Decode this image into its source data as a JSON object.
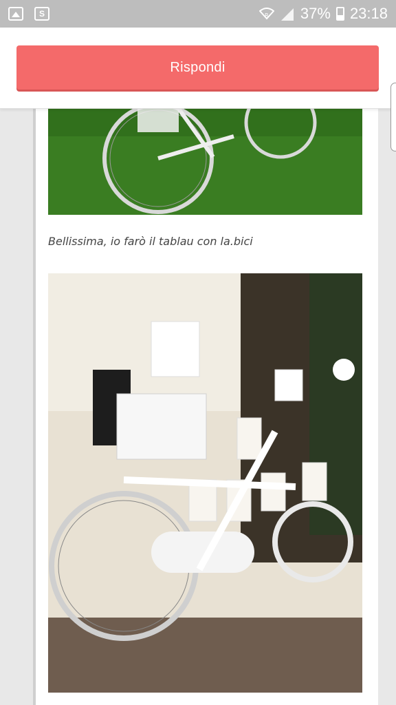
{
  "status_bar": {
    "battery": "37%",
    "time": "23:18",
    "left_icons": [
      "image-icon",
      "s-icon"
    ],
    "right_icons": [
      "wifi-icon",
      "signal-icon",
      "battery-icon"
    ]
  },
  "header": {
    "reply_label": "Rispondi",
    "accent_color": "#f46a6a"
  },
  "post": {
    "caption": "Bellissima, io farò il tablau con la.bici",
    "image_top": "bicycle-on-grass-image",
    "image_bottom": "decorated-bicycle-seating-plan-image"
  }
}
